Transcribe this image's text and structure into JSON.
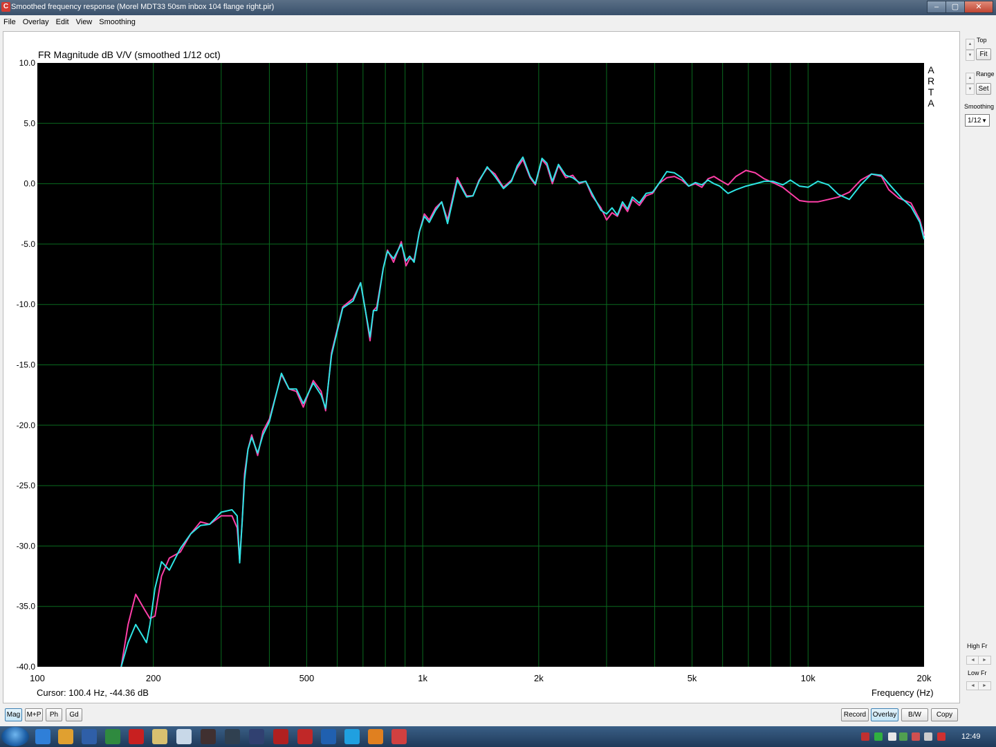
{
  "window": {
    "title": "Smoothed frequency response (Morel MDT33 50sm inbox 104 flange right.pir)",
    "app_icon": "C",
    "buttons": [
      "–",
      "▢",
      "✕"
    ]
  },
  "menu": [
    "File",
    "Overlay",
    "Edit",
    "View",
    "Smoothing"
  ],
  "side_panel": {
    "top_label": "Top",
    "fit_label": "Fit",
    "range_label": "Range",
    "set_label": "Set",
    "smoothing_label": "Smoothing",
    "smoothing_value": "1/12",
    "high_fr_label": "High Fr",
    "low_fr_label": "Low Fr"
  },
  "arta_letters": [
    "A",
    "R",
    "T",
    "A"
  ],
  "cursor_readout": "Cursor: 100.4 Hz, -44.36 dB",
  "bottom_left_buttons": [
    "Mag",
    "M+P",
    "Ph",
    "Gd"
  ],
  "bottom_right_buttons": [
    "Record",
    "Overlay",
    "B/W",
    "Copy"
  ],
  "taskbar": {
    "time": "12:49"
  },
  "colors": {
    "plot_bg": "#000000",
    "grid": "#0a6b1f",
    "series_overlay": "#ff3fa8",
    "series_current": "#2ee6e6"
  },
  "chart_data": {
    "type": "line",
    "title": "FR Magnitude dB V/V (smoothed 1/12 oct)",
    "xlabel": "Frequency (Hz)",
    "ylabel": "",
    "x_scale": "log",
    "xlim": [
      100,
      20000
    ],
    "ylim": [
      -40,
      10
    ],
    "x_ticks": [
      100,
      200,
      500,
      1000,
      2000,
      5000,
      10000,
      20000
    ],
    "x_tick_labels": [
      "100",
      "200",
      "500",
      "1k",
      "2k",
      "5k",
      "10k",
      "20k"
    ],
    "y_ticks": [
      10,
      5,
      0,
      -5,
      -10,
      -15,
      -20,
      -25,
      -30,
      -35,
      -40
    ],
    "y_tick_labels": [
      "10.0",
      "5.0",
      "0.0",
      "-5.0",
      "-10.0",
      "-15.0",
      "-20.0",
      "-25.0",
      "-30.0",
      "-35.0",
      "-40.0"
    ],
    "grid": true,
    "series": [
      {
        "color": "#ff3fa8",
        "points": [
          [
            165,
            -40
          ],
          [
            172,
            -36.5
          ],
          [
            180,
            -34
          ],
          [
            190,
            -35.3
          ],
          [
            196,
            -36
          ],
          [
            202,
            -35.8
          ],
          [
            210,
            -32.5
          ],
          [
            220,
            -31
          ],
          [
            235,
            -30.5
          ],
          [
            250,
            -29
          ],
          [
            265,
            -28
          ],
          [
            280,
            -28.2
          ],
          [
            300,
            -27.5
          ],
          [
            320,
            -27.5
          ],
          [
            330,
            -28.5
          ],
          [
            335,
            -31.2
          ],
          [
            340,
            -28
          ],
          [
            345,
            -24
          ],
          [
            352,
            -22
          ],
          [
            360,
            -20.8
          ],
          [
            373,
            -22.5
          ],
          [
            385,
            -20.5
          ],
          [
            400,
            -19.5
          ],
          [
            430,
            -15.8
          ],
          [
            450,
            -17
          ],
          [
            470,
            -17.2
          ],
          [
            490,
            -18.5
          ],
          [
            520,
            -16.3
          ],
          [
            545,
            -17.2
          ],
          [
            560,
            -18.8
          ],
          [
            580,
            -14
          ],
          [
            620,
            -10.2
          ],
          [
            660,
            -9.5
          ],
          [
            690,
            -8.2
          ],
          [
            710,
            -10.5
          ],
          [
            730,
            -13
          ],
          [
            745,
            -10.5
          ],
          [
            760,
            -10.2
          ],
          [
            790,
            -7
          ],
          [
            810,
            -5.5
          ],
          [
            840,
            -6.5
          ],
          [
            880,
            -4.8
          ],
          [
            905,
            -6.8
          ],
          [
            925,
            -6.2
          ],
          [
            950,
            -6.3
          ],
          [
            980,
            -4
          ],
          [
            1010,
            -2.5
          ],
          [
            1040,
            -3
          ],
          [
            1080,
            -2
          ],
          [
            1120,
            -1.5
          ],
          [
            1160,
            -3
          ],
          [
            1230,
            0.5
          ],
          [
            1300,
            -1
          ],
          [
            1350,
            -1
          ],
          [
            1400,
            0.3
          ],
          [
            1470,
            1.3
          ],
          [
            1540,
            0.8
          ],
          [
            1620,
            -0.3
          ],
          [
            1700,
            0.3
          ],
          [
            1760,
            1.3
          ],
          [
            1820,
            2
          ],
          [
            1900,
            0.5
          ],
          [
            1960,
            -0.1
          ],
          [
            2040,
            2
          ],
          [
            2100,
            1.5
          ],
          [
            2170,
            0
          ],
          [
            2250,
            1.5
          ],
          [
            2350,
            0.5
          ],
          [
            2450,
            0.7
          ],
          [
            2550,
            0
          ],
          [
            2650,
            0.2
          ],
          [
            2750,
            -1
          ],
          [
            2900,
            -2
          ],
          [
            3000,
            -3
          ],
          [
            3100,
            -2.4
          ],
          [
            3200,
            -2.7
          ],
          [
            3300,
            -1.7
          ],
          [
            3400,
            -2.3
          ],
          [
            3500,
            -1.3
          ],
          [
            3650,
            -1.8
          ],
          [
            3800,
            -1
          ],
          [
            3950,
            -0.8
          ],
          [
            4100,
            0
          ],
          [
            4300,
            0.5
          ],
          [
            4500,
            0.6
          ],
          [
            4700,
            0.3
          ],
          [
            4900,
            -0.2
          ],
          [
            5100,
            0
          ],
          [
            5300,
            -0.3
          ],
          [
            5500,
            0.4
          ],
          [
            5700,
            0.6
          ],
          [
            5900,
            0.3
          ],
          [
            6200,
            -0.1
          ],
          [
            6500,
            0.6
          ],
          [
            6900,
            1.1
          ],
          [
            7300,
            0.9
          ],
          [
            7700,
            0.4
          ],
          [
            8100,
            0.1
          ],
          [
            8600,
            -0.3
          ],
          [
            9000,
            -0.8
          ],
          [
            9500,
            -1.4
          ],
          [
            10000,
            -1.5
          ],
          [
            10600,
            -1.5
          ],
          [
            11300,
            -1.3
          ],
          [
            12000,
            -1.1
          ],
          [
            12800,
            -0.7
          ],
          [
            13700,
            0.3
          ],
          [
            14600,
            0.8
          ],
          [
            15500,
            0.6
          ],
          [
            16200,
            -0.5
          ],
          [
            17200,
            -1.2
          ],
          [
            18500,
            -1.6
          ],
          [
            19500,
            -3
          ],
          [
            20000,
            -4.3
          ]
        ]
      },
      {
        "color": "#2ee6e6",
        "points": [
          [
            165,
            -40
          ],
          [
            172,
            -38
          ],
          [
            180,
            -36.5
          ],
          [
            188,
            -37.5
          ],
          [
            192,
            -38
          ],
          [
            196,
            -36.5
          ],
          [
            202,
            -33.5
          ],
          [
            210,
            -31.3
          ],
          [
            220,
            -32
          ],
          [
            235,
            -30.2
          ],
          [
            250,
            -29
          ],
          [
            265,
            -28.3
          ],
          [
            280,
            -28.2
          ],
          [
            300,
            -27.2
          ],
          [
            320,
            -27
          ],
          [
            330,
            -27.5
          ],
          [
            335,
            -31.4
          ],
          [
            340,
            -28
          ],
          [
            345,
            -24.5
          ],
          [
            352,
            -22
          ],
          [
            360,
            -21
          ],
          [
            373,
            -22.3
          ],
          [
            385,
            -20.8
          ],
          [
            400,
            -19.7
          ],
          [
            430,
            -15.7
          ],
          [
            450,
            -17
          ],
          [
            470,
            -17
          ],
          [
            490,
            -18.2
          ],
          [
            520,
            -16.5
          ],
          [
            545,
            -17.5
          ],
          [
            560,
            -18.6
          ],
          [
            580,
            -14.2
          ],
          [
            620,
            -10.3
          ],
          [
            660,
            -9.7
          ],
          [
            690,
            -8.2
          ],
          [
            710,
            -10.5
          ],
          [
            730,
            -12.7
          ],
          [
            745,
            -10.5
          ],
          [
            760,
            -10.5
          ],
          [
            790,
            -7
          ],
          [
            810,
            -5.6
          ],
          [
            840,
            -6.2
          ],
          [
            880,
            -5
          ],
          [
            905,
            -6.4
          ],
          [
            925,
            -6
          ],
          [
            950,
            -6.5
          ],
          [
            980,
            -4
          ],
          [
            1010,
            -2.7
          ],
          [
            1040,
            -3.2
          ],
          [
            1080,
            -2.2
          ],
          [
            1120,
            -1.5
          ],
          [
            1160,
            -3.3
          ],
          [
            1230,
            0.3
          ],
          [
            1300,
            -1.1
          ],
          [
            1350,
            -1
          ],
          [
            1400,
            0.2
          ],
          [
            1470,
            1.4
          ],
          [
            1540,
            0.6
          ],
          [
            1620,
            -0.4
          ],
          [
            1700,
            0.2
          ],
          [
            1760,
            1.5
          ],
          [
            1820,
            2.2
          ],
          [
            1900,
            0.6
          ],
          [
            1960,
            0
          ],
          [
            2040,
            2.1
          ],
          [
            2100,
            1.7
          ],
          [
            2170,
            0.2
          ],
          [
            2250,
            1.6
          ],
          [
            2350,
            0.7
          ],
          [
            2450,
            0.5
          ],
          [
            2550,
            0.1
          ],
          [
            2650,
            0.2
          ],
          [
            2750,
            -0.8
          ],
          [
            2900,
            -2.2
          ],
          [
            3000,
            -2.5
          ],
          [
            3100,
            -2
          ],
          [
            3200,
            -2.6
          ],
          [
            3300,
            -1.5
          ],
          [
            3400,
            -2.1
          ],
          [
            3500,
            -1.1
          ],
          [
            3650,
            -1.6
          ],
          [
            3800,
            -0.8
          ],
          [
            3950,
            -0.7
          ],
          [
            4100,
            0
          ],
          [
            4300,
            1
          ],
          [
            4500,
            0.9
          ],
          [
            4700,
            0.5
          ],
          [
            4900,
            -0.2
          ],
          [
            5100,
            0.1
          ],
          [
            5300,
            -0.1
          ],
          [
            5500,
            0.3
          ],
          [
            5700,
            0
          ],
          [
            5900,
            -0.2
          ],
          [
            6200,
            -0.8
          ],
          [
            6500,
            -0.5
          ],
          [
            6900,
            -0.2
          ],
          [
            7300,
            0
          ],
          [
            7700,
            0.2
          ],
          [
            8100,
            0.2
          ],
          [
            8600,
            -0.1
          ],
          [
            9000,
            0.3
          ],
          [
            9500,
            -0.2
          ],
          [
            10000,
            -0.3
          ],
          [
            10600,
            0.2
          ],
          [
            11300,
            -0.1
          ],
          [
            12000,
            -0.9
          ],
          [
            12800,
            -1.3
          ],
          [
            13700,
            -0.1
          ],
          [
            14600,
            0.8
          ],
          [
            15500,
            0.7
          ],
          [
            16500,
            -0.3
          ],
          [
            17500,
            -1.2
          ],
          [
            18500,
            -1.9
          ],
          [
            19500,
            -3.2
          ],
          [
            20000,
            -4.6
          ]
        ]
      }
    ]
  }
}
